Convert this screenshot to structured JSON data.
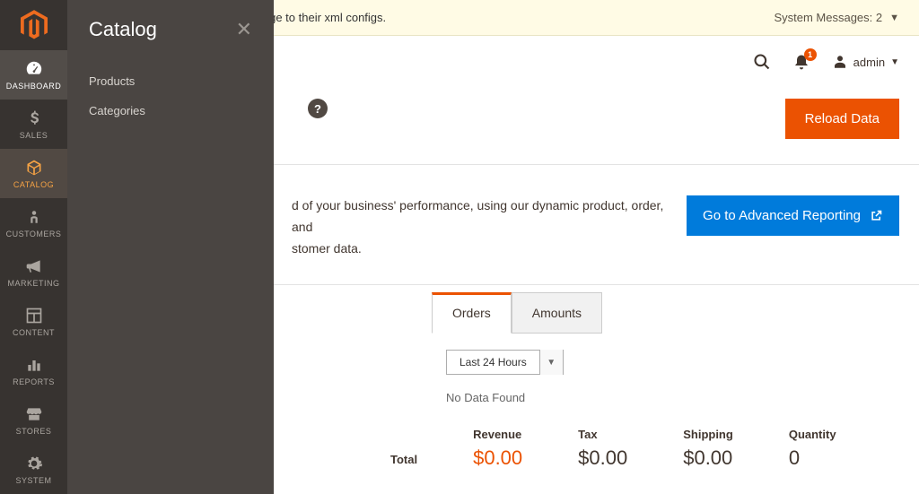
{
  "sidebar": {
    "items": [
      {
        "label": "DASHBOARD"
      },
      {
        "label": "SALES"
      },
      {
        "label": "CATALOG"
      },
      {
        "label": "CUSTOMERS"
      },
      {
        "label": "MARKETING"
      },
      {
        "label": "CONTENT"
      },
      {
        "label": "REPORTS"
      },
      {
        "label": "STORES"
      },
      {
        "label": "SYSTEM"
      }
    ]
  },
  "flyout": {
    "title": "Catalog",
    "items": [
      {
        "label": "Products"
      },
      {
        "label": "Categories"
      }
    ]
  },
  "sysmsg": {
    "text": "have been reset because of a change to their xml configs.",
    "count_label": "System Messages: 2"
  },
  "header": {
    "notif_count": "1",
    "username": "admin"
  },
  "page": {
    "help": "?",
    "reload_label": "Reload Data",
    "adv_text_1": "d of your business' performance, using our dynamic product, order, and",
    "adv_text_2": "stomer data.",
    "adv_button": "Go to Advanced Reporting"
  },
  "tabs": {
    "orders": "Orders",
    "amounts": "Amounts"
  },
  "filter": {
    "selected": "Last 24 Hours"
  },
  "nodata": "No Data Found",
  "totals": {
    "label": "Total",
    "revenue_title": "Revenue",
    "revenue_value": "$0.00",
    "tax_title": "Tax",
    "tax_value": "$0.00",
    "shipping_title": "Shipping",
    "shipping_value": "$0.00",
    "quantity_title": "Quantity",
    "quantity_value": "0"
  }
}
